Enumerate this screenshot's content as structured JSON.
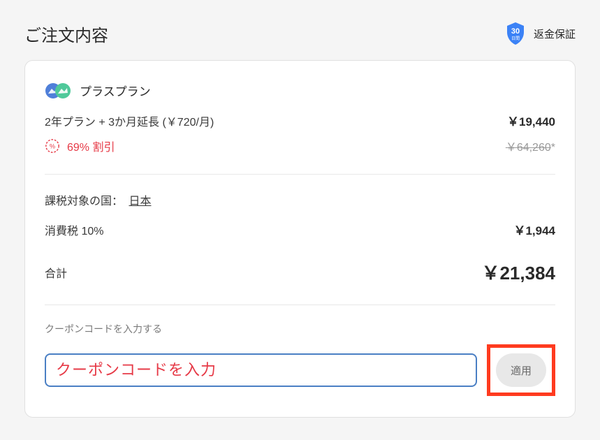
{
  "header": {
    "title": "ご注文内容",
    "guarantee_label": "返金保証",
    "badge_days": "30",
    "badge_unit": "日間"
  },
  "plan": {
    "name": "プラスプラン",
    "description": "2年プラン + 3か月延長 (￥720/月)",
    "price_current": "￥19,440",
    "discount_label": "69% 割引",
    "price_original": "￥64,260",
    "price_asterisk": "*"
  },
  "tax": {
    "country_label": "課税対象の国：",
    "country_value": "日本",
    "rate_label": "消費税 10%",
    "amount": "￥1,944"
  },
  "total": {
    "label": "合計",
    "amount": "￥21,384"
  },
  "coupon": {
    "label": "クーポンコードを入力する",
    "placeholder": "クーポンコードを入力",
    "apply_label": "適用"
  }
}
